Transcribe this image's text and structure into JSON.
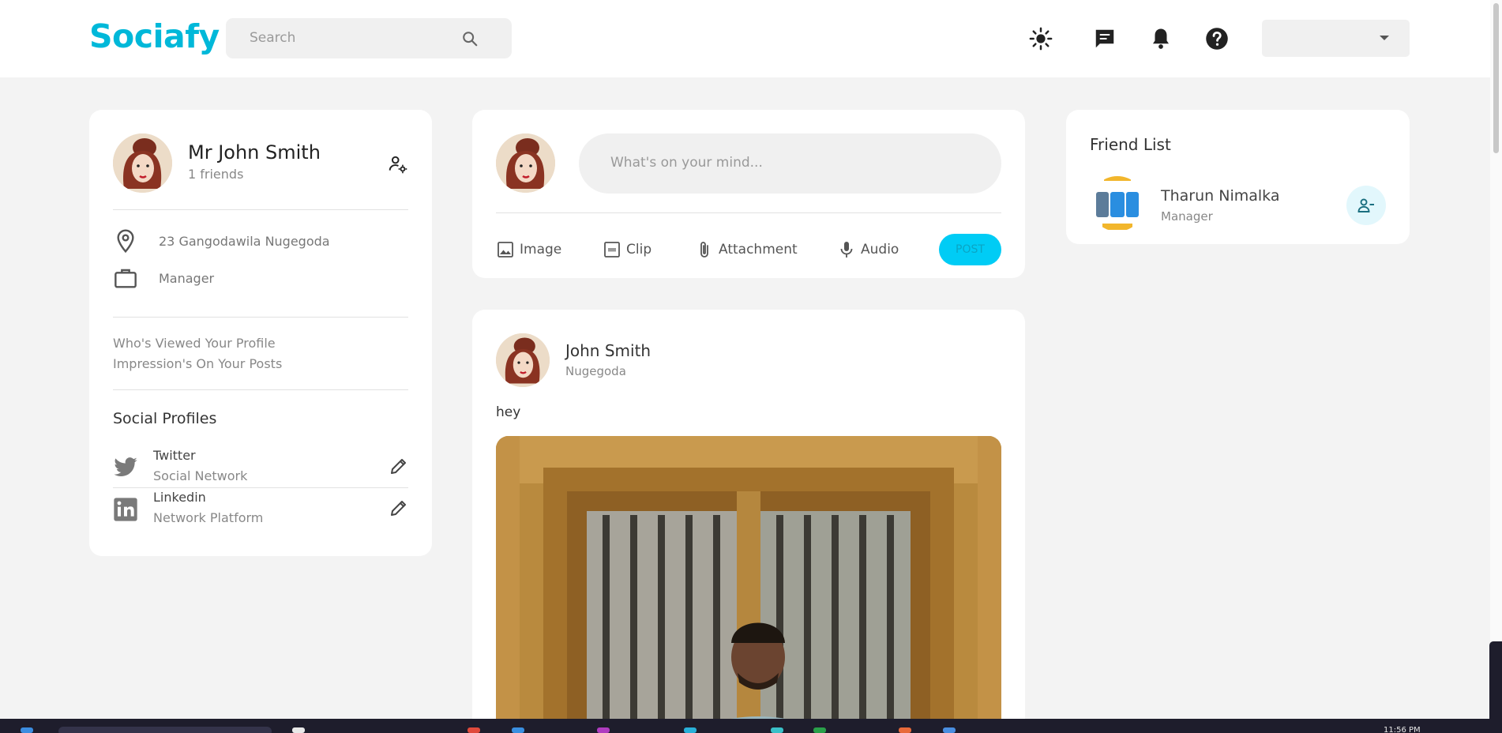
{
  "app": {
    "logo": "Sociafy"
  },
  "header": {
    "search_placeholder": "Search",
    "icons": [
      "sun-icon",
      "chat-icon",
      "bell-icon",
      "help-icon"
    ],
    "user_dropdown_value": ""
  },
  "profile": {
    "name": "Mr John Smith",
    "friends": "1 friends",
    "location": "23 Gangodawila Nugegoda",
    "occupation": "Manager",
    "stats": [
      "Who's Viewed Your Profile",
      "Impression's On Your Posts"
    ],
    "social_title": "Social Profiles",
    "socials": [
      {
        "name": "Twitter",
        "desc": "Social Network",
        "icon": "twitter-icon"
      },
      {
        "name": "Linkedin",
        "desc": "Network Platform",
        "icon": "linkedin-icon"
      }
    ]
  },
  "composer": {
    "placeholder": "What's on your mind...",
    "actions": [
      "Image",
      "Clip",
      "Attachment",
      "Audio"
    ],
    "post_label": "POST"
  },
  "post": {
    "author": "John Smith",
    "location": "Nugegoda",
    "text": "hey"
  },
  "friends": {
    "title": "Friend List",
    "items": [
      {
        "name": "Tharun Nimalka",
        "role": "Manager"
      }
    ]
  },
  "taskbar": {
    "clock": "11:56 PM"
  },
  "colors": {
    "accent": "#00b8d9",
    "post_button": "#00ccf5",
    "background": "#f3f3f3"
  }
}
